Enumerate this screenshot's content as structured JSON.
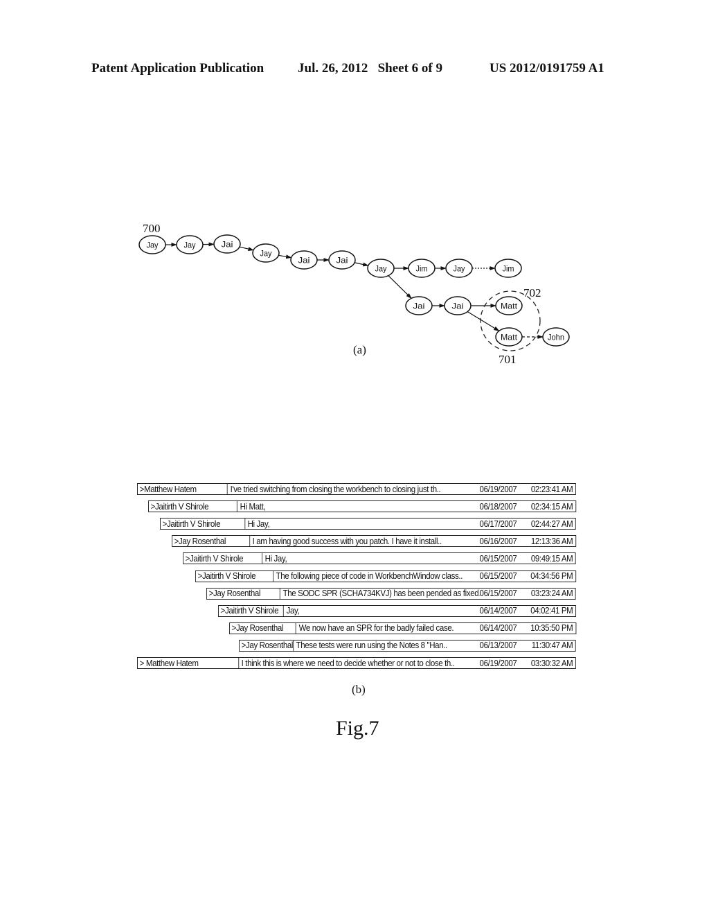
{
  "header": {
    "publication": "Patent Application Publication",
    "date_sheet": "Jul. 26, 2012   Sheet 6 of 9",
    "number": "US 2012/0191759 A1"
  },
  "graph": {
    "ref_700": "700",
    "ref_701": "701",
    "ref_702": "702",
    "nodes": [
      {
        "id": "n1",
        "label": "Jay"
      },
      {
        "id": "n2",
        "label": "Jay"
      },
      {
        "id": "n3",
        "label": "Jai"
      },
      {
        "id": "n4",
        "label": "Jay"
      },
      {
        "id": "n5",
        "label": "Jai"
      },
      {
        "id": "n6",
        "label": "Jai"
      },
      {
        "id": "n7",
        "label": "Jay"
      },
      {
        "id": "n8",
        "label": "Jim"
      },
      {
        "id": "n9",
        "label": "Jay"
      },
      {
        "id": "n10",
        "label": "Jim"
      },
      {
        "id": "n11",
        "label": "Jai"
      },
      {
        "id": "n12",
        "label": "Jai"
      },
      {
        "id": "n13",
        "label": "Matt"
      },
      {
        "id": "n14",
        "label": "Matt"
      },
      {
        "id": "n15",
        "label": "John"
      }
    ],
    "edges": [
      {
        "from": "n1",
        "to": "n2",
        "style": "solid"
      },
      {
        "from": "n2",
        "to": "n3",
        "style": "solid"
      },
      {
        "from": "n3",
        "to": "n4",
        "style": "solid"
      },
      {
        "from": "n4",
        "to": "n5",
        "style": "solid"
      },
      {
        "from": "n5",
        "to": "n6",
        "style": "solid"
      },
      {
        "from": "n6",
        "to": "n7",
        "style": "solid"
      },
      {
        "from": "n7",
        "to": "n8",
        "style": "solid"
      },
      {
        "from": "n8",
        "to": "n9",
        "style": "solid"
      },
      {
        "from": "n9",
        "to": "n10",
        "style": "dotted"
      },
      {
        "from": "n7",
        "to": "n11",
        "style": "solid"
      },
      {
        "from": "n11",
        "to": "n12",
        "style": "solid"
      },
      {
        "from": "n12",
        "to": "n13",
        "style": "solid"
      },
      {
        "from": "n12",
        "to": "n14",
        "style": "solid"
      },
      {
        "from": "n14",
        "to": "n15",
        "style": "dashed"
      }
    ],
    "caption": "(a)"
  },
  "thread_list": {
    "caption": "(b)",
    "rows": [
      {
        "author": ">Matthew Hatem",
        "subject": "I've tried switching from closing the workbench to closing just th..",
        "date": "06/19/2007",
        "time": "02:23:41 AM"
      },
      {
        "author": ">Jaitirth V Shirole",
        "subject": "Hi Matt,",
        "date": "06/18/2007",
        "time": "02:34:15 AM"
      },
      {
        "author": ">Jaitirth V Shirole",
        "subject": "Hi Jay,",
        "date": "06/17/2007",
        "time": "02:44:27 AM"
      },
      {
        "author": ">Jay Rosenthal",
        "subject": "I am having good success with you patch. I have it install..",
        "date": "06/16/2007",
        "time": "12:13:36 AM"
      },
      {
        "author": ">Jaitirth V Shirole",
        "subject": "Hi Jay,",
        "date": "06/15/2007",
        "time": "09:49:15 AM"
      },
      {
        "author": ">Jaitirth V Shirole",
        "subject": "The following piece of code in WorkbenchWindow class..",
        "date": "06/15/2007",
        "time": "04:34:56 PM"
      },
      {
        "author": ">Jay Rosenthal",
        "subject": "The SODC SPR (SCHA734KVJ) has been pended as fixed..",
        "date": "06/15/2007",
        "time": "03:23:24 AM"
      },
      {
        "author": ">Jaitirth V Shirole",
        "subject": "Jay,",
        "date": "06/14/2007",
        "time": "04:02:41 PM"
      },
      {
        "author": ">Jay Rosenthal",
        "subject": "We now have an SPR for the badly failed case.",
        "date": "06/14/2007",
        "time": "10:35:50 PM"
      },
      {
        "author": ">Jay Rosenthal",
        "subject": "These tests were run using the Notes 8 \"Han..",
        "date": "06/13/2007",
        "time": "11:30:47 AM"
      },
      {
        "author": ">  Matthew Hatem",
        "subject": "I think this is where we need to decide whether or not to close th..",
        "date": "06/19/2007",
        "time": "03:30:32 AM"
      }
    ]
  },
  "figure_title": "Fig.7"
}
